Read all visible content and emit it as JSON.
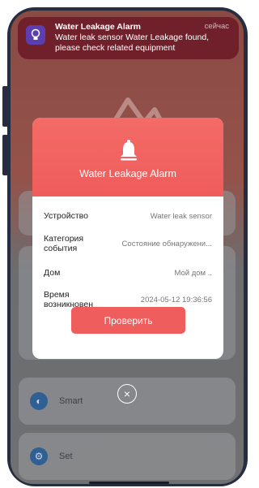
{
  "notification": {
    "title": "Water Leakage Alarm",
    "time": "сейчас",
    "body": "Water leak sensor Water Leakage found, please check related equipment"
  },
  "modal": {
    "title": "Water Leakage Alarm",
    "rows": [
      {
        "label": "Устройство",
        "value": "Water leak sensor"
      },
      {
        "label": "Категория события",
        "value": "Состояние обнаружени..."
      },
      {
        "label": "Дом",
        "value": "Мой дом .."
      },
      {
        "label": "Время возникновен",
        "value": "2024-05-12 19:36:56"
      }
    ],
    "button_label": "Проверить"
  },
  "close_glyph": "×",
  "background_menu": {
    "items": [
      {
        "label": "Smart",
        "icon": "toggle-icon"
      },
      {
        "label": "Set",
        "icon": "gear-icon"
      }
    ]
  },
  "colors": {
    "accent": "#ef5d5c",
    "notification_bg": "#6e1c28",
    "app_icon_bg": "#5b3fb1"
  }
}
